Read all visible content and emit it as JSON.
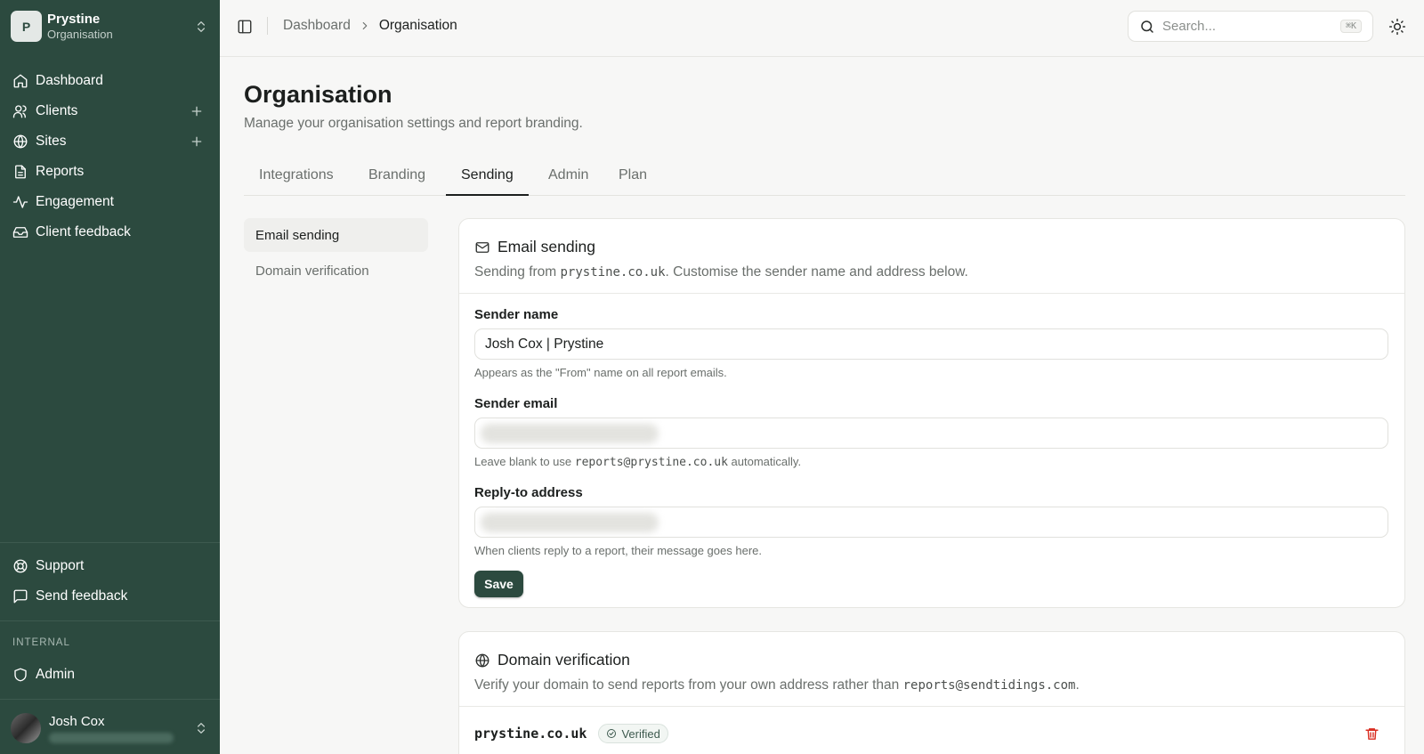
{
  "app": {
    "org_initial": "P",
    "org_name": "Prystine",
    "org_subtitle": "Organisation"
  },
  "sidebar": {
    "main_items": [
      {
        "label": "Dashboard",
        "icon": "home-icon"
      },
      {
        "label": "Clients",
        "icon": "users-icon",
        "has_add": true
      },
      {
        "label": "Sites",
        "icon": "globe-icon",
        "has_add": true
      },
      {
        "label": "Reports",
        "icon": "file-icon"
      },
      {
        "label": "Engagement",
        "icon": "activity-icon"
      },
      {
        "label": "Client feedback",
        "icon": "inbox-icon"
      }
    ],
    "footer_items": [
      {
        "label": "Support",
        "icon": "lifebuoy-icon"
      },
      {
        "label": "Send feedback",
        "icon": "message-icon"
      }
    ],
    "internal_label": "INTERNAL",
    "internal_items": [
      {
        "label": "Admin",
        "icon": "shield-icon"
      }
    ],
    "user_name": "Josh Cox"
  },
  "topbar": {
    "breadcrumb": [
      "Dashboard",
      "Organisation"
    ],
    "search_placeholder": "Search...",
    "search_shortcut": "⌘K"
  },
  "page": {
    "title": "Organisation",
    "subtitle": "Manage your organisation settings and report branding.",
    "tabs": [
      "Integrations",
      "Branding",
      "Sending",
      "Admin",
      "Plan"
    ],
    "active_tab": "Sending",
    "subnav": [
      "Email sending",
      "Domain verification"
    ]
  },
  "email_card": {
    "title": "Email sending",
    "desc_prefix": "Sending from ",
    "desc_domain": "prystine.co.uk",
    "desc_suffix": ". Customise the sender name and address below.",
    "sender_name_label": "Sender name",
    "sender_name_value": "Josh Cox | Prystine",
    "sender_name_help": "Appears as the \"From\" name on all report emails.",
    "sender_email_label": "Sender email",
    "sender_email_help_prefix": "Leave blank to use ",
    "sender_email_help_code": "reports@prystine.co.uk",
    "sender_email_help_suffix": " automatically.",
    "reply_to_label": "Reply-to address",
    "reply_to_help": "When clients reply to a report, their message goes here.",
    "save_label": "Save"
  },
  "domain_card": {
    "title": "Domain verification",
    "desc_prefix": "Verify your domain to send reports from your own address rather than ",
    "desc_code": "reports@sendtidings.com",
    "desc_suffix": ".",
    "domain": "prystine.co.uk",
    "status": "Verified"
  },
  "colors": {
    "sidebar_bg": "#2c4a3f",
    "accent": "#2c4a3f",
    "danger": "#d92d20"
  }
}
